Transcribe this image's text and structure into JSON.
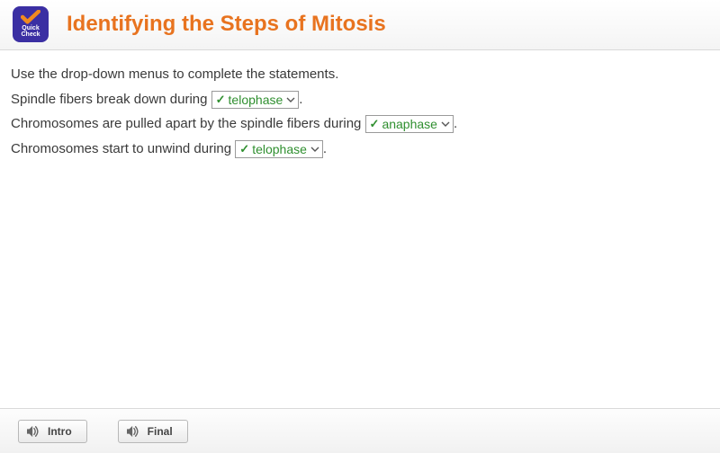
{
  "badge": {
    "line1": "Quick",
    "line2": "Check"
  },
  "title": "Identifying the Steps of Mitosis",
  "instructions": "Use the drop-down menus to complete the statements.",
  "statements": [
    {
      "before": "Spindle fibers break down during ",
      "value": "telophase",
      "after": "."
    },
    {
      "before": "Chromosomes are pulled apart by the spindle fibers during ",
      "value": "anaphase",
      "after": "."
    },
    {
      "before": "Chromosomes start to unwind during ",
      "value": "telophase",
      "after": "."
    }
  ],
  "buttons": {
    "intro": "Intro",
    "final": "Final"
  }
}
